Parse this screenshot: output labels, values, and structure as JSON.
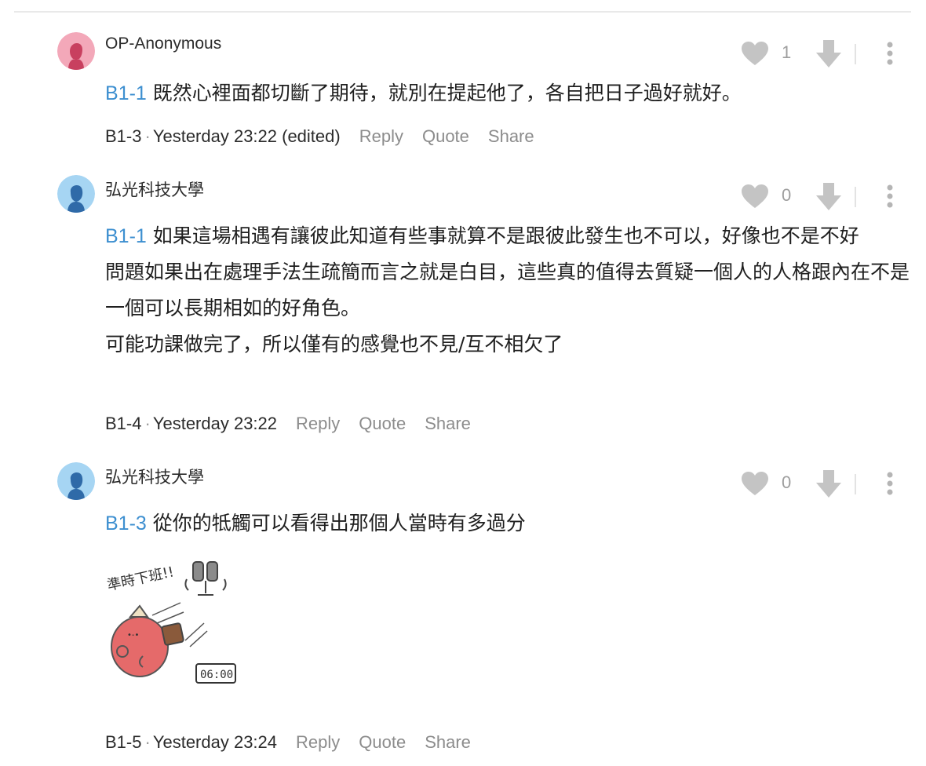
{
  "comments": [
    {
      "username": "OP-Anonymous",
      "likes": "1",
      "ref": "B1-1",
      "lines": [
        "既然心裡面都切斷了期待，就別在提起他了，各自把日子過好就好。"
      ],
      "floor": "B1-3",
      "time": "Yesterday 23:22 (edited)",
      "avatar": "female-avatar-icon"
    },
    {
      "username": "弘光科技大學",
      "likes": "0",
      "ref": "B1-1",
      "lines": [
        "如果這場相遇有讓彼此知道有些事就算不是跟彼此發生也不可以，好像也不是不好",
        "問題如果出在處理手法生疏簡而言之就是白目，這些真的值得去質疑一個人的人格跟內在不是一個可以長期相如的好角色。",
        "可能功課做完了，所以僅有的感覺也不見/互不相欠了"
      ],
      "floor": "B1-4",
      "time": "Yesterday 23:22",
      "avatar": "male-avatar-icon"
    },
    {
      "username": "弘光科技大學",
      "likes": "0",
      "ref": "B1-3",
      "lines": [
        "從你的牴觸可以看得出那個人當時有多過分"
      ],
      "floor": "B1-5",
      "time": "Yesterday 23:24",
      "avatar": "male-avatar-icon",
      "sticker": {
        "text": "準時下班!!",
        "clock": "06:00"
      }
    }
  ],
  "actions": {
    "reply": "Reply",
    "quote": "Quote",
    "share": "Share",
    "dot": "·"
  },
  "colors": {
    "link_blue": "#3d8fd0",
    "icon_gray": "#c4c4c4",
    "avatar_female_bg": "#f3a8b9",
    "avatar_male_bg": "#a6d5f3"
  }
}
